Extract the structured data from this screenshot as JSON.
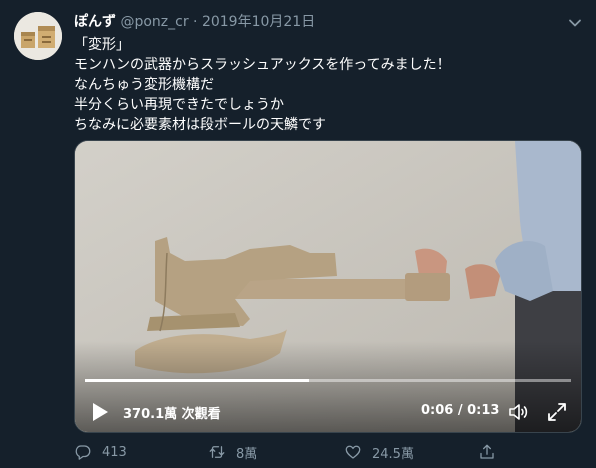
{
  "user": {
    "name": "ぽんず",
    "handle": "@ponz_cr",
    "separator": "·",
    "date": "2019年10月21日"
  },
  "tweet": {
    "lines": [
      "「変形」",
      "モンハンの武器からスラッシュアックスを作ってみました！",
      "なんちゅう変形機構だ",
      "半分くらい再現できたでしょうか",
      "ちなみに必要素材は段ボールの天鱗です"
    ]
  },
  "video": {
    "views": "370.1萬 次觀看",
    "time": "0:06 / 0:13",
    "progress": 0.46
  },
  "actions": {
    "replies": "413",
    "retweets": "8萬",
    "likes": "24.5萬"
  },
  "colors": {
    "background": "#15202b",
    "secondary_text": "#8899a6",
    "primary_text": "#ffffff"
  },
  "icons": [
    "caret-down-icon",
    "play-icon",
    "volume-icon",
    "fullscreen-icon",
    "reply-icon",
    "retweet-icon",
    "like-icon",
    "share-icon"
  ]
}
